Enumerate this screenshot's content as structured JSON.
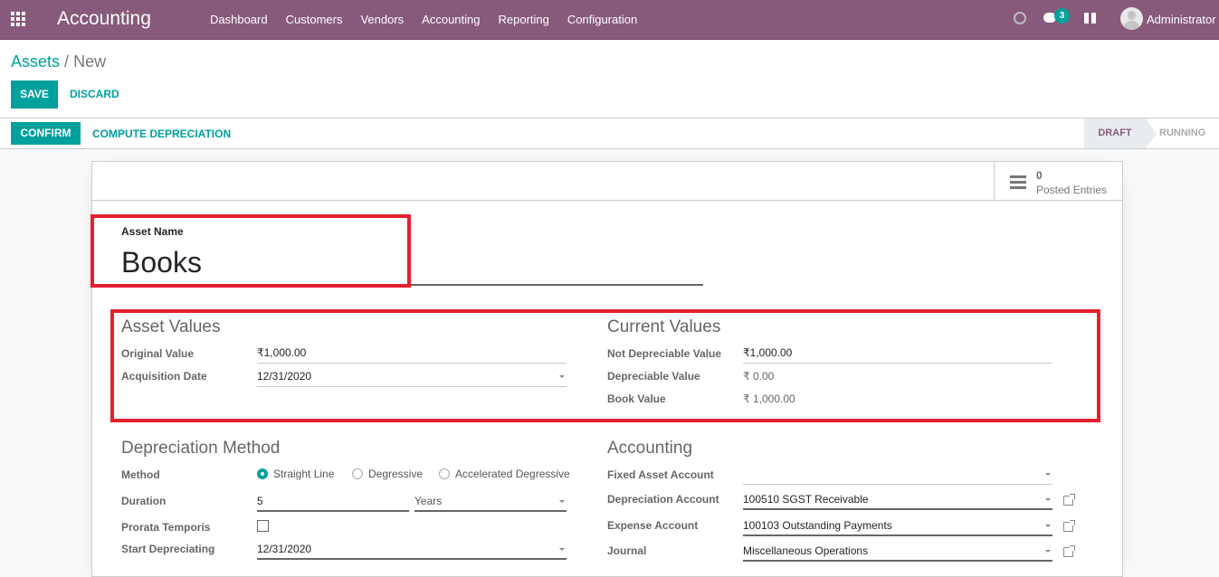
{
  "navbar": {
    "app_name": "Accounting",
    "menu": [
      "Dashboard",
      "Customers",
      "Vendors",
      "Accounting",
      "Reporting",
      "Configuration"
    ],
    "messages_badge": "3",
    "user_name": "Administrator",
    "brand_color": "#875a7b",
    "accent_color": "#00a09d"
  },
  "breadcrumb": {
    "parent": "Assets",
    "separator": "/",
    "current": "New"
  },
  "toolbar": {
    "save_label": "SAVE",
    "discard_label": "DISCARD"
  },
  "statusbar": {
    "confirm_label": "CONFIRM",
    "compute_label": "COMPUTE DEPRECIATION",
    "stages": [
      "DRAFT",
      "RUNNING"
    ],
    "active_stage": "DRAFT"
  },
  "stat_button": {
    "value": "0",
    "label": "Posted Entries"
  },
  "asset_name": {
    "label": "Asset Name",
    "value": "Books"
  },
  "asset_values": {
    "title": "Asset Values",
    "original_value_label": "Original Value",
    "original_value": "₹1,000.00",
    "acquisition_date_label": "Acquisition Date",
    "acquisition_date": "12/31/2020"
  },
  "current_values": {
    "title": "Current Values",
    "not_depreciable_label": "Not Depreciable Value",
    "not_depreciable_value": "₹1,000.00",
    "depreciable_label": "Depreciable Value",
    "depreciable_value": "₹ 0.00",
    "book_value_label": "Book Value",
    "book_value": "₹ 1,000.00"
  },
  "depreciation_method": {
    "title": "Depreciation Method",
    "method_label": "Method",
    "methods": [
      "Straight Line",
      "Degressive",
      "Accelerated Degressive"
    ],
    "selected_method": "Straight Line",
    "duration_label": "Duration",
    "duration_value": "5",
    "duration_unit": "Years",
    "prorata_label": "Prorata Temporis",
    "prorata_checked": false,
    "start_label": "Start Depreciating",
    "start_value": "12/31/2020"
  },
  "accounting": {
    "title": "Accounting",
    "fixed_asset_label": "Fixed Asset Account",
    "fixed_asset_value": "",
    "depreciation_label": "Depreciation Account",
    "depreciation_value": "100510 SGST Receivable",
    "expense_label": "Expense Account",
    "expense_value": "100103 Outstanding Payments",
    "journal_label": "Journal",
    "journal_value": "Miscellaneous Operations"
  }
}
